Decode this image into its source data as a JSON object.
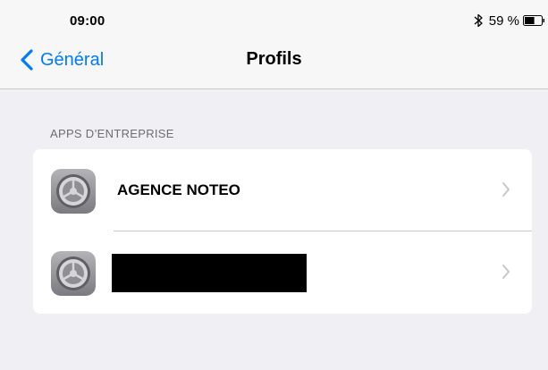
{
  "status_bar": {
    "time": "09:00",
    "bluetooth_icon": "bluetooth-icon",
    "battery_percent": "59 %",
    "battery_icon": "battery-icon",
    "battery_level": 0.59
  },
  "nav": {
    "back_label": "Général",
    "back_icon": "chevron-left-icon",
    "title": "Profils",
    "accent_color": "#007aff"
  },
  "section": {
    "header": "APPS D’ENTREPRISE",
    "items": [
      {
        "icon": "settings-gear-icon",
        "label": "AGENCE NOTEO",
        "chevron": "chevron-right-icon"
      },
      {
        "icon": "settings-gear-icon",
        "label": "",
        "redacted": true,
        "chevron": "chevron-right-icon"
      }
    ]
  }
}
